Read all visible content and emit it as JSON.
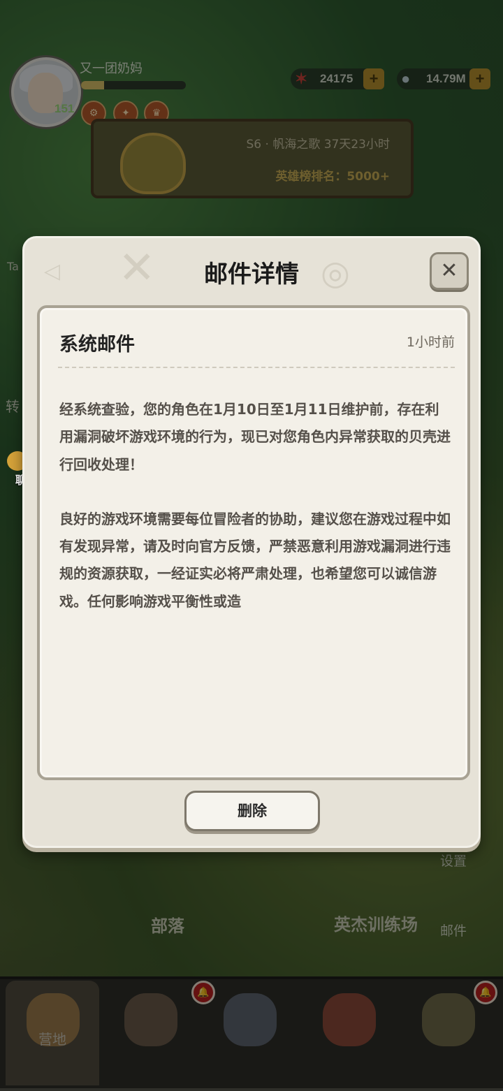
{
  "player": {
    "name": "又一团奶妈",
    "level": "151",
    "xp_progress": 0.22
  },
  "currencies": [
    {
      "icon": "starfish-icon",
      "value": "24175"
    },
    {
      "icon": "shell-icon",
      "value": "14.79M"
    }
  ],
  "season": {
    "title": "S6 · 帆海之歌 37天23小时",
    "rank": "英雄榜排名：5000+"
  },
  "side_labels": {
    "left_top": "Ta",
    "left_mid": "转",
    "settings": "设置",
    "mail": "邮件"
  },
  "scene": {
    "tribe": "部落",
    "training": "英杰训练场"
  },
  "chat": {
    "label": "聊天"
  },
  "dialog": {
    "title": "邮件详情",
    "close_symbol": "✕",
    "mail": {
      "subject": "系统邮件",
      "time": "1小时前",
      "paragraphs": [
        "经系统查验，您的角色在1月10日至1月11日维护前，存在利用漏洞破坏游戏环境的行为，现已对您角色内异常获取的贝壳进行回收处理！",
        "良好的游戏环境需要每位冒险者的协助，建议您在游戏过程中如有发现异常，请及时向官方反馈，严禁恶意利用游戏漏洞进行违规的资源获取，一经证实必将严肃处理，也希望您可以诚信游戏。任何影响游戏平衡性或造"
      ]
    },
    "delete_label": "删除"
  },
  "bottom_nav": {
    "camp_label": "营地"
  },
  "colors": {
    "dialog_bg": "#e6e2d7",
    "panel_bg": "#f3f0e8",
    "button_border": "#7e786b"
  }
}
